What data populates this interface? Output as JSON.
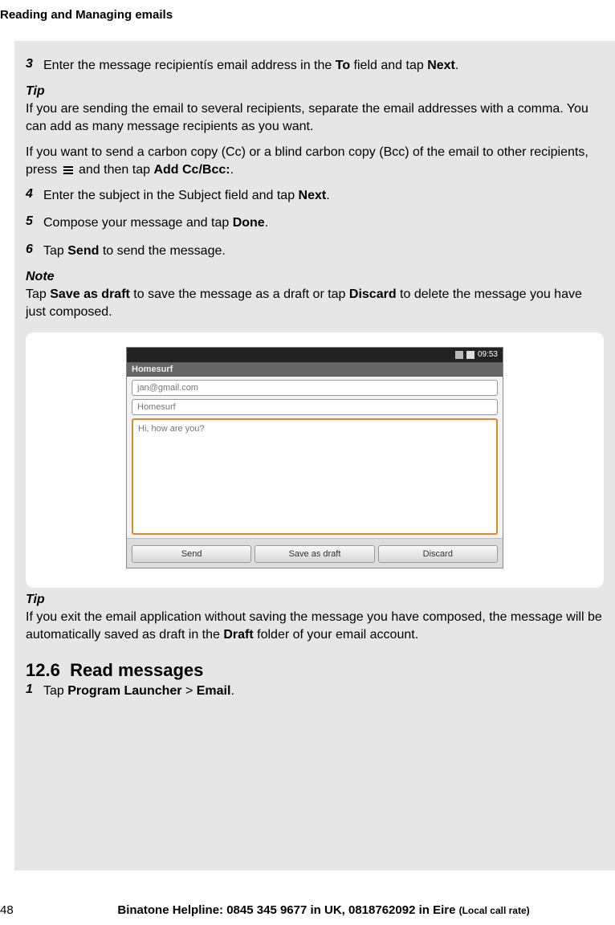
{
  "header": "Reading and Managing emails",
  "steps": {
    "s3_num": "3",
    "s3_a": "Enter the message recipientís email address in the ",
    "s3_b1": "To",
    "s3_c": " field and tap ",
    "s3_b2": "Next",
    "s3_d": ".",
    "s4_num": "4",
    "s4_a": "Enter the subject in the Subject field and tap ",
    "s4_b": "Next",
    "s4_c": ".",
    "s5_num": "5",
    "s5_a": "Compose your message and tap ",
    "s5_b": "Done",
    "s5_c": ".",
    "s6_num": "6",
    "s6_a": "Tap ",
    "s6_b": "Send",
    "s6_c": " to send the message."
  },
  "tip1": {
    "label": "Tip",
    "text": " If you are sending the email to several recipients, separate the email addresses with a comma. You can add as many message recipients as you want."
  },
  "cc": {
    "a": "If you want to send a carbon copy (Cc) or a blind carbon copy (Bcc) of the email to other recipients, press ",
    "b": " and then tap ",
    "bold": "Add Cc/Bcc:",
    "c": "."
  },
  "note": {
    "label": "Note",
    "a": "Tap ",
    "b1": "Save as draft",
    "c": " to save the message as a draft or tap ",
    "b2": "Discard",
    "d": " to delete the message you have just composed."
  },
  "shot": {
    "time": "09:53",
    "title": "Homesurf",
    "to": "jan@gmail.com",
    "subject": "Homesurf",
    "body": "Hi, how are you?",
    "btn_send": "Send",
    "btn_save": "Save as draft",
    "btn_discard": "Discard"
  },
  "tip2": {
    "label": "Tip",
    "a": "If you exit the email application without saving the message you have composed, the message will be automatically saved as draft in the ",
    "b": "Draft",
    "c": " folder of your email account."
  },
  "section": {
    "num": "12.6",
    "title": "Read messages",
    "s1_num": "1",
    "s1_a": "Tap ",
    "s1_b1": "Program Launcher",
    "s1_gt": " > ",
    "s1_b2": "Email",
    "s1_c": "."
  },
  "footer": {
    "page": "48",
    "text": "Binatone Helpline: 0845 345 9677 in UK, 0818762092 in Eire ",
    "small": "(Local call rate)"
  }
}
